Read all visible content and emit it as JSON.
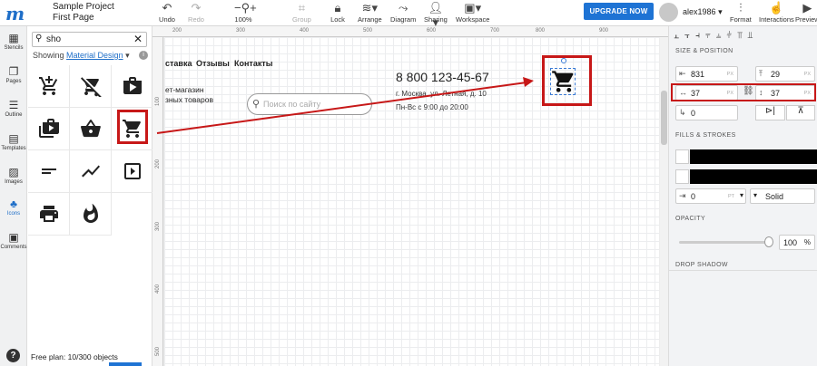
{
  "app": {
    "project_name": "Sample Project",
    "page_name": "First Page"
  },
  "toolbar": {
    "undo": "Undo",
    "redo": "Redo",
    "zoom": "100%",
    "group": "Group",
    "lock": "Lock",
    "arrange": "Arrange",
    "diagram": "Diagram",
    "sharing": "Sharing",
    "workspace": "Workspace",
    "upgrade": "UPGRADE NOW",
    "username": "alex1986",
    "format": "Format",
    "interactions": "Interactions",
    "preview": "Preview"
  },
  "rail": {
    "stencils": "Stencils",
    "pages": "Pages",
    "outline": "Outline",
    "templates": "Templates",
    "images": "Images",
    "icons": "Icons",
    "comments": "Comments",
    "help": "?"
  },
  "icon_panel": {
    "search_value": "sho",
    "showing_prefix": "Showing",
    "showing_link": "Material Design",
    "free_plan": "Free plan: 10/300 objects",
    "icons": [
      "add-shopping-cart-icon",
      "remove-shopping-cart-icon",
      "shop-icon",
      "shop-two-icon",
      "shopping-basket-icon",
      "shopping-cart-icon",
      "short-text-icon",
      "show-chart-icon",
      "slideshow-icon",
      "print-icon",
      "whatshot-icon"
    ]
  },
  "rulers": {
    "h": [
      "200",
      "300",
      "400",
      "500",
      "600",
      "700",
      "800",
      "900"
    ],
    "v": [
      "100",
      "200",
      "300",
      "400",
      "500"
    ]
  },
  "canvas": {
    "menu": [
      "ставка",
      "Отзывы",
      "Контакты"
    ],
    "shop_line1": "ет-магазин",
    "shop_line2": "зных товаров",
    "search_placeholder": "Поиск по сайту",
    "phone": "8 800 123-45-67",
    "address": "г. Москва, ул. Летная, д. 10",
    "hours": "Пн-Вс с 9:00 до 20:00"
  },
  "inspector": {
    "size_position": "SIZE & POSITION",
    "x": "831",
    "y": "29",
    "width": "37",
    "height": "37",
    "rotation": "0",
    "unit_px": "PX",
    "fills_strokes": "FILLS & STROKES",
    "stroke_width": "0",
    "stroke_unit": "PT",
    "stroke_style": "Solid",
    "opacity_label": "OPACITY",
    "opacity": "100",
    "opacity_unit": "%",
    "drop_shadow": "DROP SHADOW"
  },
  "colors": {
    "accent": "#1e73d4",
    "highlight": "#c71818"
  }
}
